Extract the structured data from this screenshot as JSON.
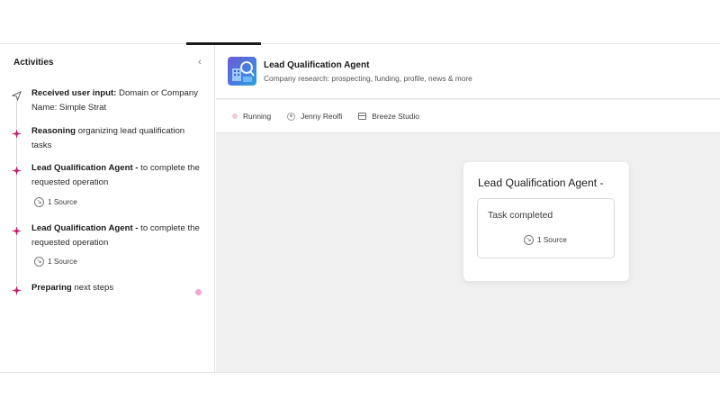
{
  "sidebar": {
    "title": "Activities",
    "collapse_icon": "chevron-left-icon",
    "activities": [
      {
        "icon": "send-icon",
        "bold": "Received user input:",
        "rest": " Domain or Company Name: Simple Strat"
      },
      {
        "icon": "sparkle-icon",
        "bold": "Reasoning",
        "rest": " organizing lead qualification tasks"
      },
      {
        "icon": "sparkle-icon",
        "bold": "Lead Qualification Agent -",
        "rest": " to complete the requested operation",
        "source": "1 Source"
      },
      {
        "icon": "sparkle-icon",
        "bold": "Lead Qualification Agent -",
        "rest": " to complete the requested operation",
        "source": "1 Source"
      },
      {
        "icon": "sparkle-icon",
        "bold": "Preparing",
        "rest": " next steps"
      }
    ]
  },
  "agent": {
    "title": "Lead Qualification Agent",
    "subtitle": "Company research: prospecting, funding, profile, news & more",
    "avatar_icon": "agent-avatar-icon"
  },
  "meta": {
    "status": "Running",
    "owner": "Jenny Reolfi",
    "studio": "Breeze Studio"
  },
  "card": {
    "title": "Lead Qualification Agent -",
    "status": "Task completed",
    "source": "1 Source"
  },
  "colors": {
    "sparkle": "#c2186b",
    "status_dot": "#f6c9de",
    "pink_dot": "#f3a7cf",
    "canvas_bg": "#f0f0f0"
  }
}
